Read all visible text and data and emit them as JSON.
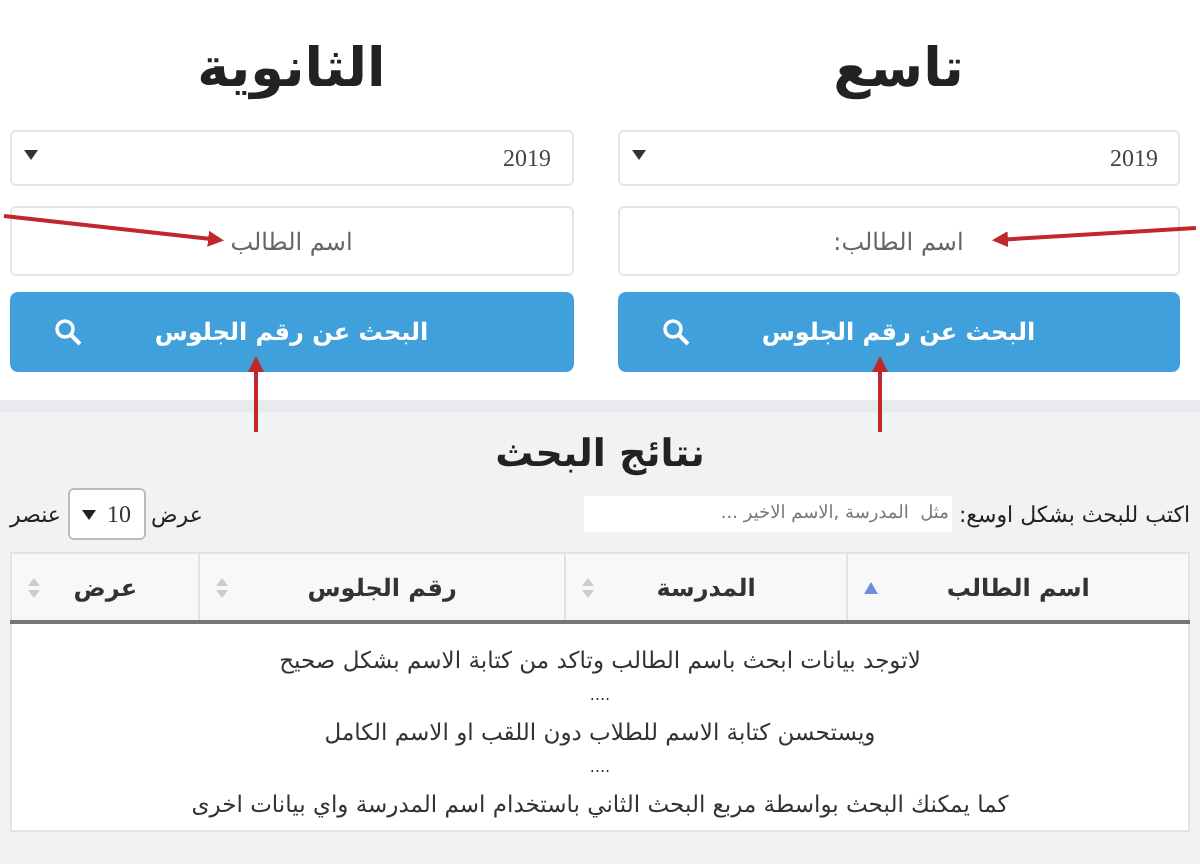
{
  "forms": [
    {
      "title": "تاسع",
      "year": "2019",
      "name_placeholder": "اسم الطالب:",
      "button": "البحث عن رقم الجلوس"
    },
    {
      "title": "الثانوية",
      "year": "2019",
      "name_placeholder": "اسم الطالب",
      "button": "البحث عن رقم الجلوس"
    }
  ],
  "results": {
    "title": "نتائج البحث",
    "search_label": "اكتب للبحث بشكل اوسع:",
    "search_placeholder": "مثل  المدرسة ,الاسم الاخير ...",
    "length_prefix": "عرض",
    "length_value": "10",
    "length_suffix": "عنصر",
    "columns": [
      {
        "label": "اسم الطالب",
        "sorted": true
      },
      {
        "label": "المدرسة",
        "sorted": false
      },
      {
        "label": "رقم الجلوس",
        "sorted": false
      },
      {
        "label": "عرض",
        "sorted": false
      }
    ],
    "message_lines": [
      "لاتوجد بيانات ابحث باسم الطالب وتاكد من كتابة الاسم بشكل صحيح",
      "....",
      "ويستحسن كتابة الاسم للطلاب دون اللقب او الاسم الكامل",
      "....",
      "كما يمكنك البحث بواسطة مربع البحث الثاني باستخدام اسم المدرسة واي بيانات اخرى"
    ]
  }
}
